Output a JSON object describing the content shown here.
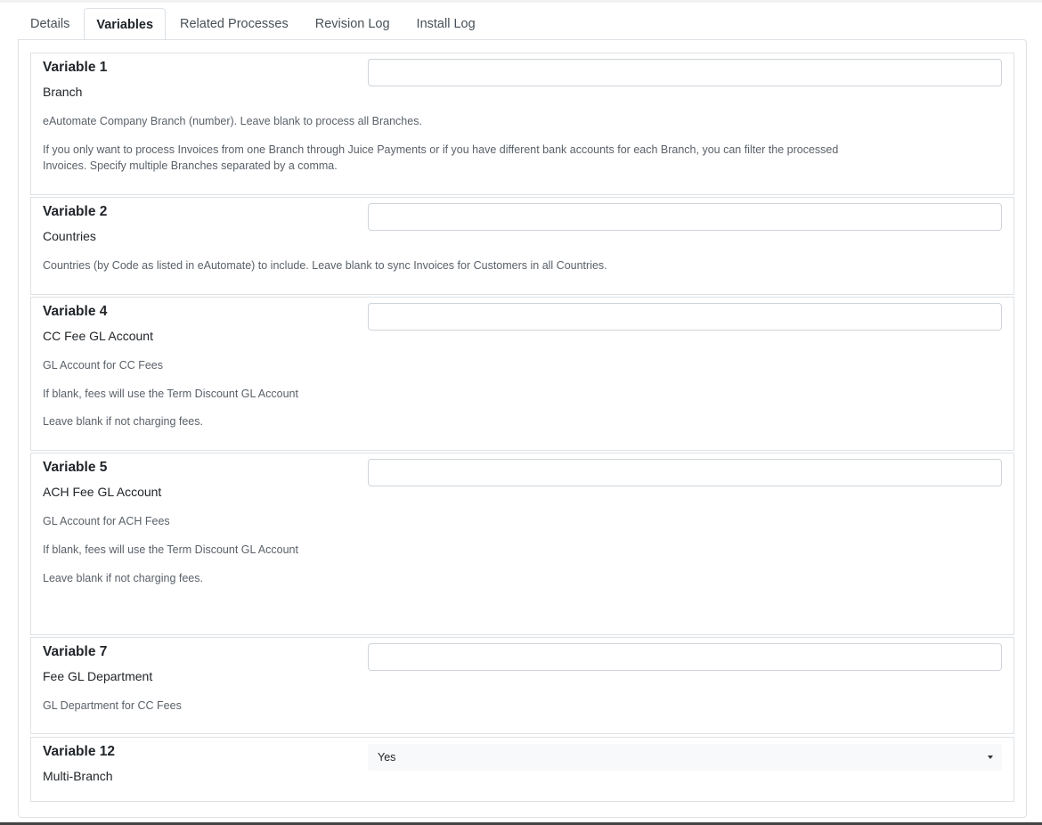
{
  "tabs": [
    {
      "label": "Details"
    },
    {
      "label": "Variables"
    },
    {
      "label": "Related Processes"
    },
    {
      "label": "Revision Log"
    },
    {
      "label": "Install Log"
    }
  ],
  "variables": [
    {
      "title": "Variable 1",
      "name": "Branch",
      "value": "",
      "description": [
        "eAutomate Company Branch (number). Leave blank to process all Branches.",
        "If you only want to process Invoices from one Branch through Juice Payments or if you have different bank accounts for each Branch, you can filter the processed Invoices. Specify multiple Branches separated by a comma."
      ]
    },
    {
      "title": "Variable 2",
      "name": "Countries",
      "value": "",
      "description": [
        "Countries (by Code as listed in eAutomate) to include. Leave blank to sync Invoices for Customers in all Countries."
      ]
    },
    {
      "title": "Variable 4",
      "name": "CC Fee GL Account",
      "value": "",
      "description": [
        "GL Account for CC Fees",
        "If blank, fees will use the Term Discount GL Account",
        "Leave blank if not charging fees."
      ]
    },
    {
      "title": "Variable 5",
      "name": "ACH Fee GL Account",
      "value": "",
      "description": [
        "GL Account for ACH Fees",
        "If blank, fees will use the Term Discount GL Account",
        "Leave blank if not charging fees."
      ]
    },
    {
      "title": "Variable 7",
      "name": "Fee GL Department",
      "value": "",
      "description": [
        "GL Department for CC Fees"
      ]
    },
    {
      "title": "Variable 12",
      "name": "Multi-Branch",
      "selected": "Yes"
    }
  ]
}
